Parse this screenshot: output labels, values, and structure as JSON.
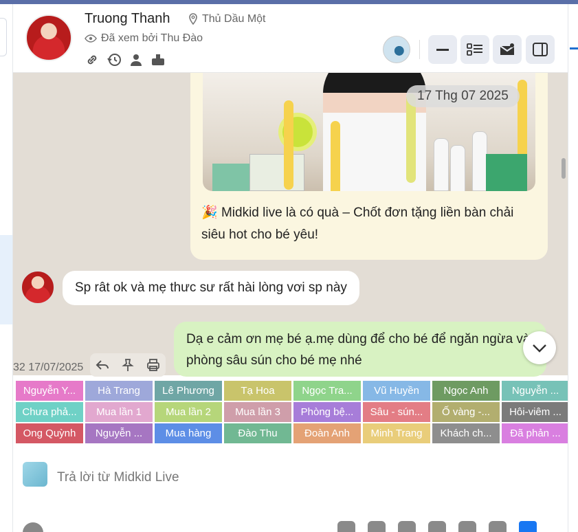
{
  "contact": {
    "name": "Truong Thanh",
    "location": "Thủ Dầu Một",
    "seen_by": "Đã xem bởi Thu Đào"
  },
  "header_icons": [
    "link-icon",
    "history-icon",
    "person-icon",
    "inbox-icon"
  ],
  "header_buttons": [
    "minimize-icon",
    "list-icon",
    "envelope-icon",
    "sidebar-icon"
  ],
  "messages": {
    "date_chip": "17 Thg 07 2025",
    "caption_emoji": "🎉",
    "caption": "Midkid live là có quà – Chốt đơn tặng liền bàn chải siêu hot cho bé yêu!",
    "incoming": "Sp rât ok và mẹ thưc sư rất hài lòng vơi sp này",
    "outgoing": "Dạ e cảm ơn mẹ bé ạ.mẹ dùng để cho bé để ngăn ngừa và phòng sâu sún cho bé mẹ nhé",
    "outgoing_meta": "32 17/07/2025"
  },
  "tags": [
    {
      "label": "Nguyễn Y...",
      "color": "#e67ac9"
    },
    {
      "label": "Hà Trang",
      "color": "#9ea8da"
    },
    {
      "label": "Lê Phương",
      "color": "#6fa6a5"
    },
    {
      "label": "Tạ Hoa",
      "color": "#c9c46b"
    },
    {
      "label": "Ngọc Tra...",
      "color": "#8fd48b"
    },
    {
      "label": "Vũ Huyền",
      "color": "#86b8e6"
    },
    {
      "label": "Ngọc Anh",
      "color": "#6e9b62"
    },
    {
      "label": "Nguyễn ...",
      "color": "#77c2b7"
    },
    {
      "label": "Chưa phả...",
      "color": "#6fd1c6"
    },
    {
      "label": "Mua lần 1",
      "color": "#e2a8cf"
    },
    {
      "label": "Mua lần 2",
      "color": "#b6d67a"
    },
    {
      "label": "Mua lần 3",
      "color": "#cf9eaa"
    },
    {
      "label": "Phòng bệ...",
      "color": "#a77dd9"
    },
    {
      "label": "Sâu - sún...",
      "color": "#e37d85"
    },
    {
      "label": "Ố vàng -...",
      "color": "#b2ae6f"
    },
    {
      "label": "Hôi-viêm ...",
      "color": "#7b7b7b"
    },
    {
      "label": "Ong Quỳnh",
      "color": "#d45864"
    },
    {
      "label": "Nguyễn ...",
      "color": "#a676c2"
    },
    {
      "label": "Mua hàng",
      "color": "#5d8ee6"
    },
    {
      "label": "Đào Thu",
      "color": "#71b893"
    },
    {
      "label": "Đoàn Anh",
      "color": "#e4a275"
    },
    {
      "label": "Minh Trang",
      "color": "#e9cd7a"
    },
    {
      "label": "Khách ch...",
      "color": "#8e8e8e"
    },
    {
      "label": "Đã phản ...",
      "color": "#d97fe0"
    }
  ],
  "reply": {
    "placeholder": "Trả lời từ Midkid Live"
  },
  "bottom_icons": [
    "call-icon",
    "gift-icon",
    "sticker-icon",
    "attachment-icon",
    "image-icon",
    "template-icon",
    "like-icon"
  ]
}
